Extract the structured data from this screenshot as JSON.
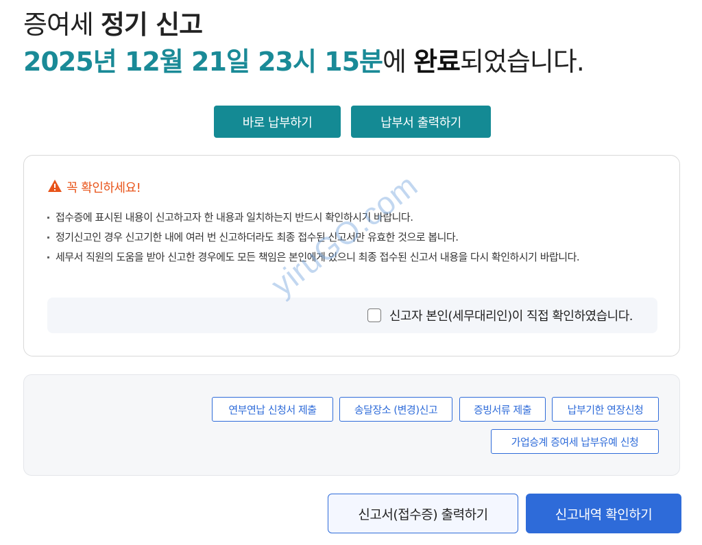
{
  "heading": {
    "line1_normal": "증여세 ",
    "line1_strong": "정기 신고",
    "line2_date": "2025년 12월 21일 23시 15분",
    "line2_mid": "에 ",
    "line2_strong": "완료",
    "line2_end": "되었습니다."
  },
  "actions": {
    "pay_now": "바로 납부하기",
    "print_payment": "납부서 출력하기"
  },
  "notice": {
    "icon": "warning-icon",
    "title": "꼭 확인하세요!",
    "items": [
      "접수증에 표시된 내용이 신고하고자 한 내용과 일치하는지 반드시 확인하시기 바랍니다.",
      "정기신고인 경우 신고기한 내에 여러 번 신고하더라도 최종 접수된 신고서만 유효한 것으로 봅니다.",
      "세무서 직원의 도움을 받아 신고한 경우에도 모든 책임은 본인에게 있으니 최종 접수된 신고서 내용을 다시 확인하시기 바랍니다."
    ],
    "confirm_label": "신고자 본인(세무대리인)이 직접 확인하였습니다.",
    "confirm_checked": false
  },
  "watermark": "yiruGO.com",
  "links": [
    "연부연납 신청서 제출",
    "송달장소 (변경)신고",
    "증빙서류 제출",
    "납부기한 연장신청",
    "가업승계 증여세 납부유예 신청"
  ],
  "footer": {
    "print_receipt": "신고서(접수증) 출력하기",
    "view_history": "신고내역 확인하기"
  },
  "colors": {
    "teal": "#148a94",
    "date_teal": "#1a8a97",
    "warning": "#e8541a",
    "primary_blue": "#2e6bd9"
  }
}
